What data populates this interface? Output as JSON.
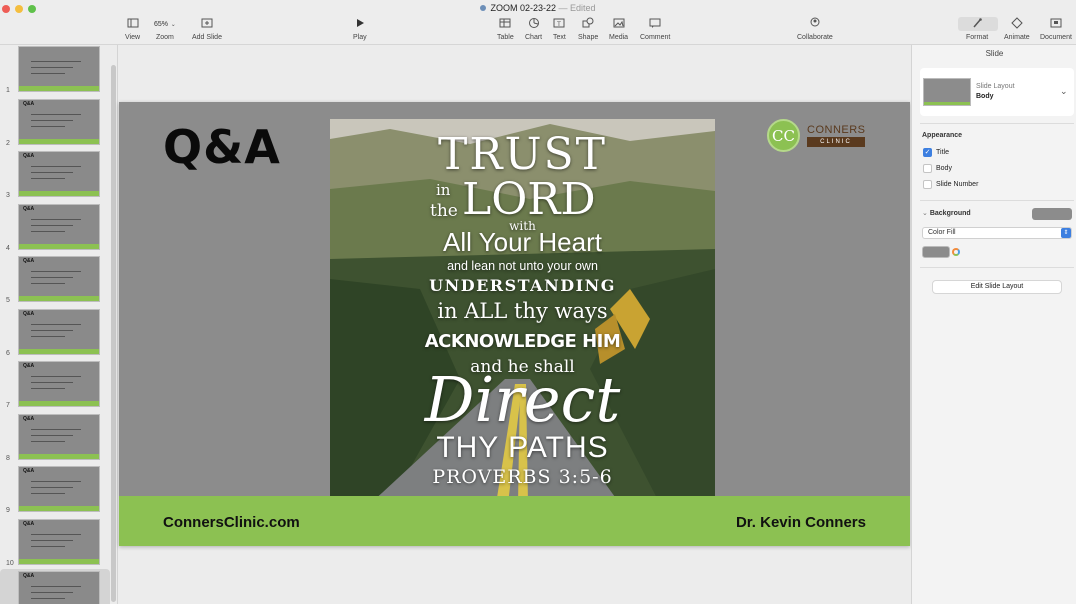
{
  "window": {
    "title": "ZOOM 02-23-22",
    "status": "— Edited"
  },
  "toolbar": {
    "view": "View",
    "zoom_value": "65%",
    "zoom": "Zoom",
    "add_slide": "Add Slide",
    "play": "Play",
    "table": "Table",
    "chart": "Chart",
    "text": "Text",
    "shape": "Shape",
    "media": "Media",
    "comment": "Comment",
    "collaborate": "Collaborate",
    "format": "Format",
    "animate": "Animate",
    "document": "Document"
  },
  "navigator": {
    "slides": [
      {
        "number": "1",
        "title": ""
      },
      {
        "number": "2",
        "title": "Q&A"
      },
      {
        "number": "3",
        "title": "Q&A"
      },
      {
        "number": "4",
        "title": "Q&A"
      },
      {
        "number": "5",
        "title": "Q&A"
      },
      {
        "number": "6",
        "title": "Q&A"
      },
      {
        "number": "7",
        "title": "Q&A"
      },
      {
        "number": "8",
        "title": "Q&A"
      },
      {
        "number": "9",
        "title": "Q&A"
      },
      {
        "number": "10",
        "title": "Q&A"
      },
      {
        "number": "11",
        "title": "Q&A"
      }
    ],
    "selected": "11"
  },
  "slide": {
    "title": "Q&A",
    "logo": {
      "initials": "CC",
      "name": "CONNERS",
      "sub": "CLINIC"
    },
    "verse": {
      "l1": "TRUST",
      "l2a": "in",
      "l2b": "the",
      "l2c": "LORD",
      "l3": "with",
      "l4": "All Your Heart",
      "l5": "and lean not unto your own",
      "l6": "UNDERSTANDING",
      "l7": "in ALL thy ways",
      "l8": "ACKNOWLEDGE HIM",
      "l9": "and he shall",
      "l10": "Direct",
      "l11": "THY PATHS",
      "l12": "PROVERBS 3:5-6"
    },
    "footer_left": "ConnersClinic.com",
    "footer_right": "Dr. Kevin Conners"
  },
  "inspector": {
    "header": "Slide",
    "layout_label": "Slide Layout",
    "layout_value": "Body",
    "appearance": "Appearance",
    "title_opt": "Title",
    "body_opt": "Body",
    "slide_number_opt": "Slide Number",
    "background": "Background",
    "fill_type": "Color Fill",
    "edit_layout": "Edit Slide Layout",
    "checked": {
      "title": true,
      "body": false,
      "slide_number": false
    }
  },
  "colors": {
    "accent_green": "#8cc152",
    "slide_gray": "#8c8c8c",
    "selection_blue": "#3d7fe0"
  }
}
